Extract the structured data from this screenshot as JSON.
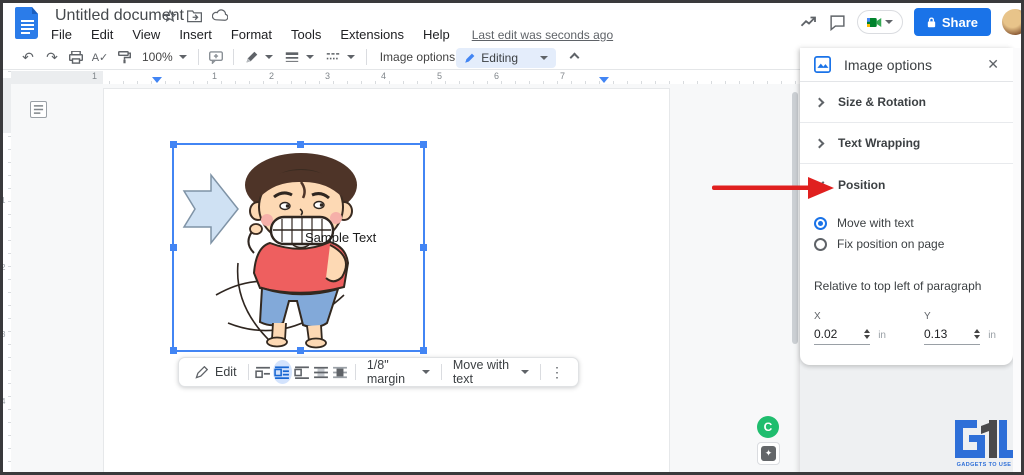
{
  "header": {
    "title": "Untitled document",
    "menu": [
      "File",
      "Edit",
      "View",
      "Insert",
      "Format",
      "Tools",
      "Extensions",
      "Help"
    ],
    "last_edit_link": "Last edit was seconds ago",
    "share_label": "Share"
  },
  "toolbar": {
    "zoom_value": "100%",
    "image_options_label": "Image options",
    "editing_label": "Editing"
  },
  "ruler": {
    "h_margin_number": "1",
    "h_numbers": [
      "1",
      "2",
      "3",
      "4",
      "5",
      "6",
      "7"
    ],
    "v_numbers": [
      "1",
      "2",
      "3",
      "4"
    ]
  },
  "document": {
    "sample_text": "Sample Text"
  },
  "image_toolbar": {
    "edit_label": "Edit",
    "margin_value": "1/8\" margin",
    "position_value": "Move with text"
  },
  "panel": {
    "title": "Image options",
    "section_size": "Size & Rotation",
    "section_wrap": "Text Wrapping",
    "section_position": "Position",
    "radio_move_label": "Move with text",
    "radio_fix_label": "Fix position on page",
    "relative_label": "Relative to top left of paragraph",
    "x_label": "X",
    "x_value": "0.02",
    "x_unit": "in",
    "y_label": "Y",
    "y_value": "0.13",
    "y_unit": "in"
  },
  "extensions": {
    "badge_letter": "C",
    "sparkle_glyph": "✦"
  },
  "watermark": {
    "text": "GADGETS TO USE"
  },
  "colors": {
    "accent_blue": "#1a73e8",
    "selection_blue": "#4285f4",
    "editing_pill": "#e4edfb",
    "arrow_red": "#e0201f",
    "canvas_gray": "#f7f8f9",
    "logo_blue": "#2e6fd8",
    "extension_green": "#1fbd6e"
  }
}
